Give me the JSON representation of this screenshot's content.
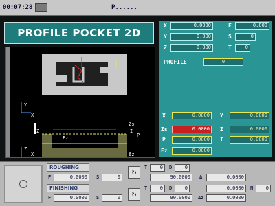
{
  "topbar": {
    "clock": "00:07:28",
    "program": "P......"
  },
  "title": "PROFILE POCKET 2D",
  "axes": {
    "x": "0.0000",
    "y": "0.000",
    "z": "0.000",
    "f": "0.000",
    "s": "0",
    "t": "0"
  },
  "axis_labels": {
    "x": "X",
    "y": "Y",
    "z": "Z",
    "f": "F",
    "s": "S",
    "t": "T"
  },
  "profile": {
    "label": "PROFILE",
    "value": "0"
  },
  "params": {
    "x_label": "X",
    "x": "0.0000",
    "y_label": "Y",
    "y": "0.0000",
    "zs_label": "Zs",
    "zs": "0.0000",
    "z_label": "Z",
    "z": "0.0000",
    "p_label": "P",
    "p": "0.0000",
    "i_label": "I",
    "i": "0.0000",
    "fz_label": "Fz",
    "fz": "0.0000"
  },
  "diagram": {
    "z_label": "Z",
    "zs_label": "Zs",
    "p_label": "P",
    "i_label": "I",
    "fz_label": "Fz",
    "dz_label": "Δz",
    "y_axis": "Y",
    "x_axis": "X",
    "z_axis_left": "Z",
    "x_axis_left": "X"
  },
  "roughing": {
    "label": "ROUGHING",
    "f_label": "F",
    "f": "0.0000",
    "s_label": "S",
    "s": "0",
    "t_label": "T",
    "t": "0",
    "d_label": "D",
    "d": "0",
    "angle": "90.0000",
    "delta_label": "Δ",
    "delta": "0.0000"
  },
  "finishing": {
    "label": "FINISHING",
    "f_label": "F",
    "f": "0.0000",
    "s_label": "S",
    "s": "0",
    "t_label": "T",
    "t": "0",
    "d_label": "D",
    "d": "0",
    "n_label": "N",
    "n": "0",
    "delta": "0.0000",
    "angle": "90.0000",
    "dz_label": "Δz",
    "dz": "0.0000",
    "extra": "0.0000"
  },
  "rotate_glyph": "↻",
  "icons": [
    "clock-mode-icon",
    "rotation-icon",
    "tool-icon"
  ]
}
